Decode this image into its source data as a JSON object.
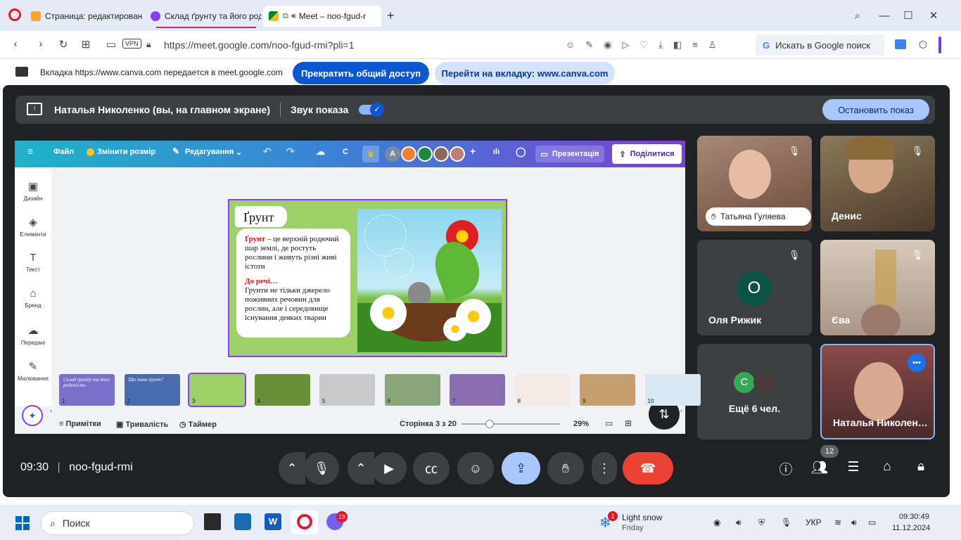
{
  "browser": {
    "tabs": [
      {
        "title": "Страница: редактирован",
        "active": false
      },
      {
        "title": "Склад ґрунту та його род",
        "active": false
      },
      {
        "title": "Meet – noo-fgud-r",
        "active": true
      }
    ],
    "new_tab": "+",
    "url": "https://meet.google.com/noo-fgud-rmi?pli=1",
    "vpn": "VPN",
    "search_box": "Искать в Google поиск"
  },
  "sharebar": {
    "message": "Вкладка https://www.canva.com передается в meet.google.com",
    "stop_button": "Прекратить общий доступ",
    "goto_button": "Перейти на вкладку: www.canva.com"
  },
  "presenting": {
    "label": "Наталья Николенко (вы, на главном экране)",
    "audio_label": "Звук показа",
    "stop_button": "Остановить показ"
  },
  "canva": {
    "menu": {
      "file": "Файл",
      "resize": "Змінити розмір",
      "edit": "Редагування",
      "c": "C",
      "avatar_letter": "A",
      "present": "Презентація",
      "share": "Поділитися"
    },
    "sidebar": [
      {
        "label": "Дизайн",
        "icon": "layout-icon"
      },
      {
        "label": "Елементи",
        "icon": "shapes-icon"
      },
      {
        "label": "Текст",
        "icon": "text-icon"
      },
      {
        "label": "Бренд",
        "icon": "brand-icon"
      },
      {
        "label": "Передані",
        "icon": "upload-icon"
      },
      {
        "label": "Малювання",
        "icon": "pen-icon"
      }
    ],
    "slide": {
      "title": "Ґрунт",
      "def_bold": "Ґрунт",
      "def_rest": " – це верхній родючий шар землі, де ростуть рослини і живуть різні живі істоти",
      "note_heading": "До речі…",
      "note_text": "Грунти  не тільки джерело поживних речовин для рослин, але і середовище існування деяких тварин"
    },
    "thumbnails": [
      {
        "num": "1",
        "color": "#7a6fc9",
        "text": "Склад ґрунту та його родючість"
      },
      {
        "num": "2",
        "color": "#4a6bb0",
        "text": "Що таке ґрунт?"
      },
      {
        "num": "3",
        "color": "#9ed06a",
        "text": ""
      },
      {
        "num": "4",
        "color": "#6a8f3a",
        "text": ""
      },
      {
        "num": "5",
        "color": "#c9c9c9",
        "text": ""
      },
      {
        "num": "6",
        "color": "#8aa57a",
        "text": ""
      },
      {
        "num": "7",
        "color": "#8a6fb0",
        "text": ""
      },
      {
        "num": "8",
        "color": "#f4ece4",
        "text": ""
      },
      {
        "num": "9",
        "color": "#c4a070",
        "text": ""
      },
      {
        "num": "10",
        "color": "#d8e8f4",
        "text": ""
      }
    ],
    "footer": {
      "notes": "Примітки",
      "duration": "Тривалість",
      "timer": "Таймер",
      "page": "Сторінка 3 з 20",
      "zoom": "29%"
    }
  },
  "participants": [
    {
      "name": "Татьяна Гуляева",
      "muted": true,
      "type": "video",
      "bg": "#8a6a5a"
    },
    {
      "name": "Денис",
      "muted": true,
      "type": "video",
      "bg": "#6a5a3a"
    },
    {
      "name": "Оля Рижик",
      "muted": true,
      "type": "avatar",
      "letter": "O",
      "avatar_color": "#0b5345"
    },
    {
      "name": "Єва",
      "muted": true,
      "type": "video",
      "bg": "#c4b6a6"
    },
    {
      "name": "Ещё 6 чел.",
      "type": "more",
      "letter": "C"
    },
    {
      "name": "Наталья Николен…",
      "type": "self",
      "bg": "#6a3a3a"
    }
  ],
  "meeting": {
    "time": "09:30",
    "code": "noo-fgud-rmi",
    "people_count": "12"
  },
  "taskbar": {
    "search": "Поиск",
    "viber_badge": "19",
    "weather_badge": "1",
    "weather": "Light snow",
    "weather_day": "Friday",
    "lang": "УКР",
    "time": "09:30:49",
    "date": "11.12.2024"
  },
  "colors": {
    "meet_bg": "#202124",
    "accent": "#8ab4f8",
    "end_call": "#ea4335",
    "canva_purple": "#8b3dff"
  }
}
